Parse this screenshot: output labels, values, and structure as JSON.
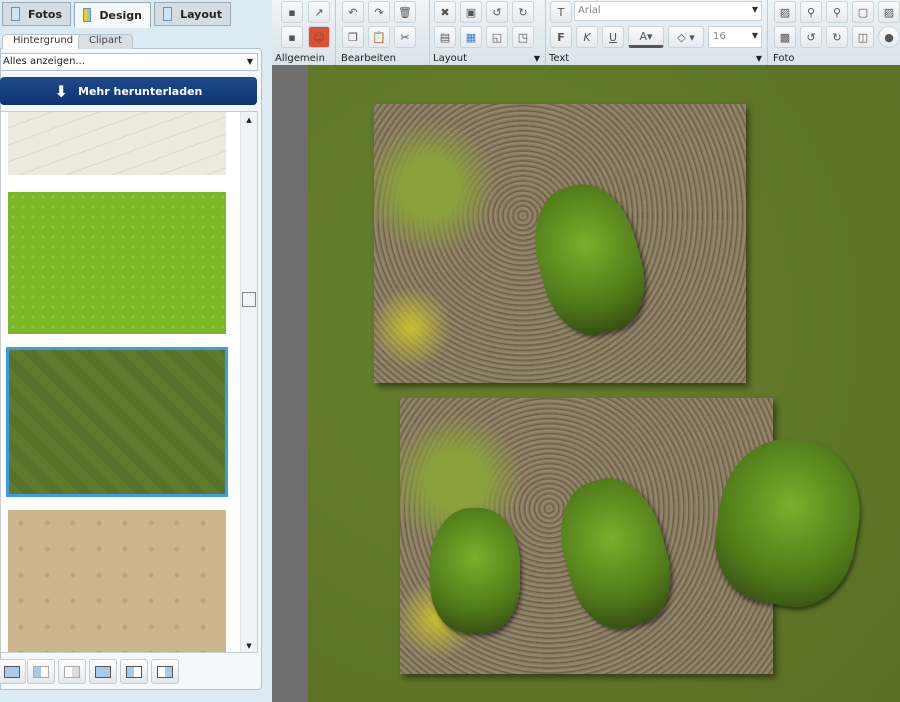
{
  "panel_tabs": [
    {
      "label": "Fotos"
    },
    {
      "label": "Design"
    },
    {
      "label": "Layout"
    }
  ],
  "sub_tabs": [
    {
      "label": "Hintergrund"
    },
    {
      "label": "Clipart"
    }
  ],
  "filter": {
    "value": "Alles anzeigen..."
  },
  "download_button": {
    "label": "Mehr herunterladen"
  },
  "backgrounds": [
    {
      "name": "beige-lines",
      "color": "#ecebe0"
    },
    {
      "name": "bright-green",
      "color": "#7ab82a"
    },
    {
      "name": "olive-green",
      "color": "#5f7a2a",
      "selected": true
    },
    {
      "name": "tan-pattern",
      "color": "#cdb68e"
    }
  ],
  "toolbar": {
    "groups": [
      {
        "label": "Allgemein"
      },
      {
        "label": "Bearbeiten"
      },
      {
        "label": "Layout"
      },
      {
        "label": "Text"
      },
      {
        "label": "Foto"
      }
    ],
    "font": "Arial",
    "font_size": "16",
    "bold": "F",
    "italic": "K",
    "underline": "U",
    "font_color": "A"
  },
  "colors": {
    "canvas": "#5e7326",
    "accent": "#0f3473"
  }
}
